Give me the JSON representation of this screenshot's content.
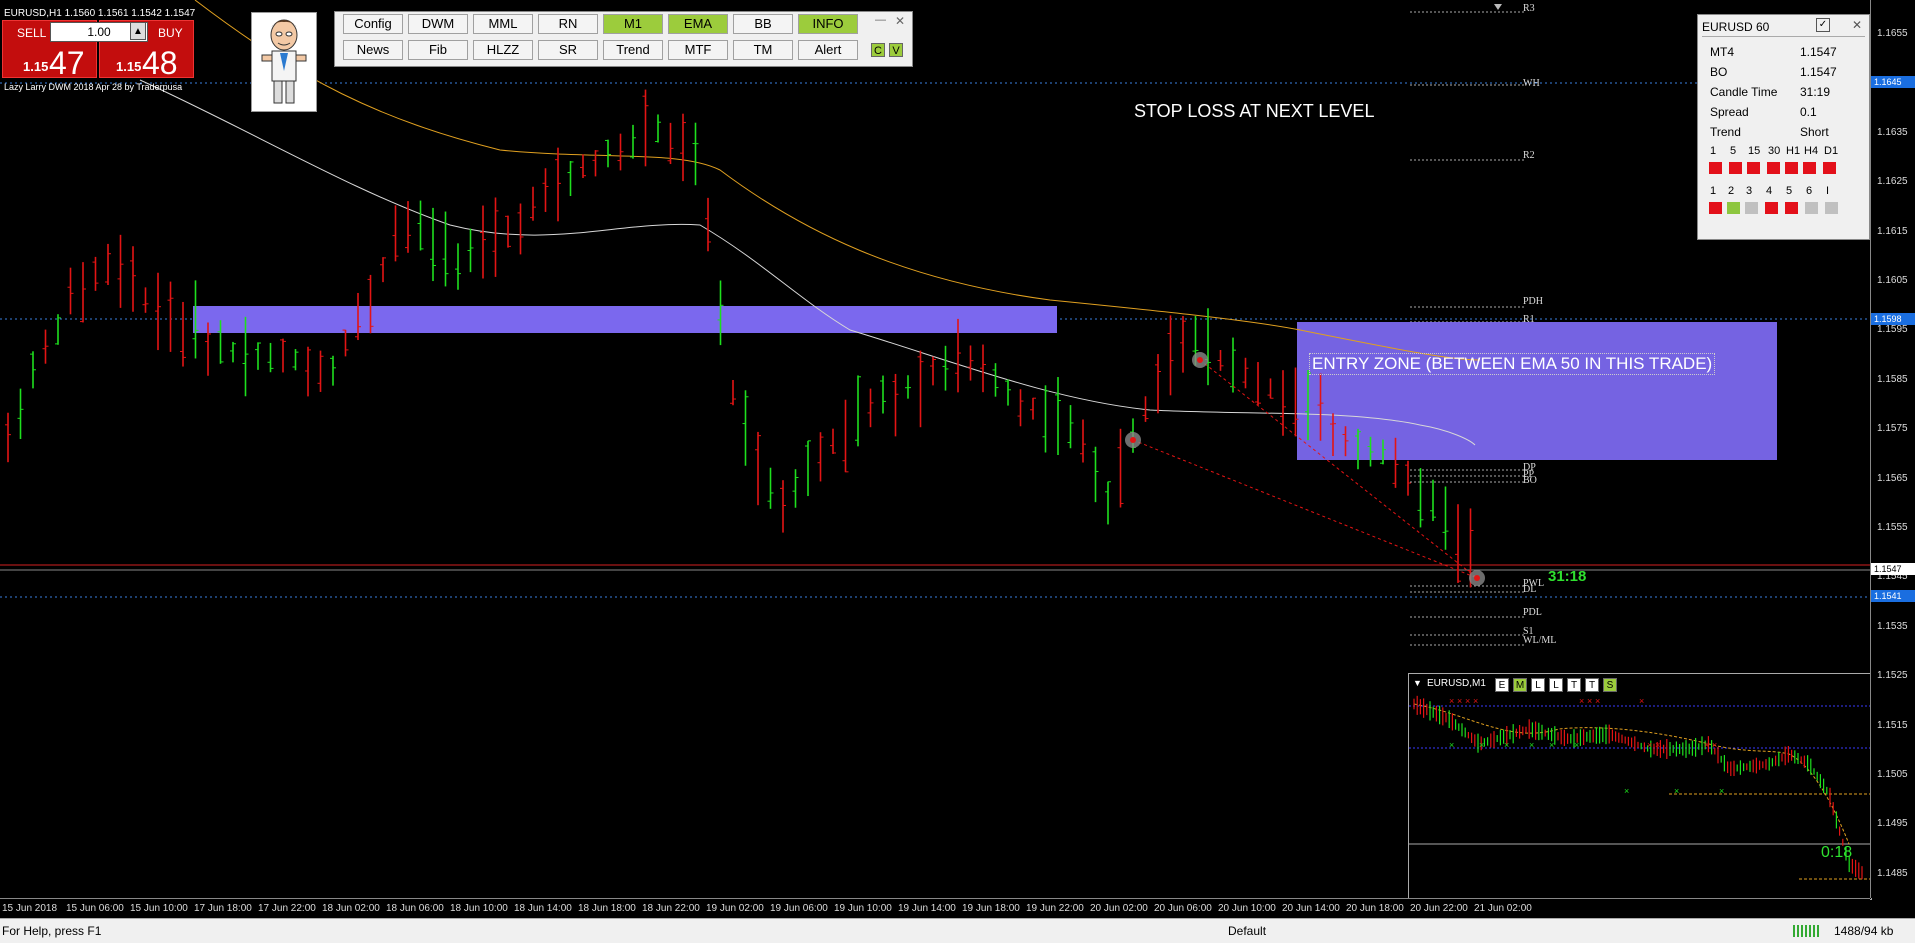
{
  "window": {
    "symbol_title": "EURUSD,H1  1.1560 1.1561 1.1542 1.1547",
    "author_label": "Lazy Larry DWM 2018 Apr 28 by Traderpusa"
  },
  "trade_panel": {
    "sell_label": "SELL",
    "buy_label": "BUY",
    "lot_value": "1.00",
    "spin_down": "▼",
    "spin_up": "▲",
    "sell_small": "1.15",
    "sell_big": "47",
    "buy_small": "1.15",
    "buy_big": "48"
  },
  "button_panel": {
    "row1": [
      "Config",
      "DWM",
      "MML",
      "RN",
      "M1",
      "EMA",
      "BB",
      "INFO"
    ],
    "row2": [
      "News",
      "Fib",
      "HLZZ",
      "SR",
      "Trend",
      "MTF",
      "TM",
      "Alert"
    ],
    "minimize": "—",
    "close": "✕",
    "c_label": "C",
    "v_label": "V"
  },
  "info_panel": {
    "title": "EURUSD  60",
    "close": "✕",
    "rows": [
      {
        "label": "MT4",
        "value": "1.1547"
      },
      {
        "label": "BO",
        "value": "1.1547"
      },
      {
        "label": "Candle Time",
        "value": "31:19"
      },
      {
        "label": "Spread",
        "value": "0.1"
      },
      {
        "label": "Trend",
        "value": "Short"
      }
    ],
    "timeframes": [
      "1",
      "5",
      "15",
      "30",
      "H1",
      "H4",
      "D1"
    ],
    "timeframe_colors": [
      "#e3101a",
      "#e3101a",
      "#e3101a",
      "#e3101a",
      "#e3101a",
      "#e3101a",
      "#e3101a"
    ],
    "signals": [
      "1",
      "2",
      "3",
      "4",
      "5",
      "6",
      "I"
    ],
    "signal_colors": [
      "#e3101a",
      "#8dc63f",
      "#c0c0c0",
      "#e3101a",
      "#e3101a",
      "#c0c0c0",
      "#c0c0c0"
    ]
  },
  "annotations": {
    "stop_loss": "STOP LOSS AT NEXT LEVEL",
    "entry_zone": "ENTRY ZONE (BETWEEN EMA 50 IN THIS TRADE)",
    "timer": "31:18"
  },
  "levels": {
    "r3": "R3",
    "wh": "WH",
    "r2": "R2",
    "pdh": "PDH",
    "r1": "R1",
    "dp": "DP",
    "pp": "PP",
    "bo": "BO",
    "pwl": "PWL",
    "dl": "DL",
    "pdl": "PDL",
    "s1": "S1",
    "wl_ml": "WL/ML"
  },
  "price_axis": [
    "1.1655",
    "1.1645",
    "1.1635",
    "1.1625",
    "1.1615",
    "1.1605",
    "1.1595",
    "1.1585",
    "1.1575",
    "1.1565",
    "1.1555",
    "1.1545",
    "1.1535",
    "1.1525",
    "1.1515",
    "1.1505",
    "1.1495",
    "1.1485"
  ],
  "price_tags": {
    "top_blue": "1.1645",
    "mid_blue": "1.1598",
    "current": "1.1547",
    "low_blue": "1.1541"
  },
  "time_axis": [
    "15 Jun 2018",
    "15 Jun 06:00",
    "15 Jun 10:00",
    "17 Jun 18:00",
    "17 Jun 22:00",
    "18 Jun 02:00",
    "18 Jun 06:00",
    "18 Jun 10:00",
    "18 Jun 14:00",
    "18 Jun 18:00",
    "18 Jun 22:00",
    "19 Jun 02:00",
    "19 Jun 06:00",
    "19 Jun 10:00",
    "19 Jun 14:00",
    "19 Jun 18:00",
    "19 Jun 22:00",
    "20 Jun 02:00",
    "20 Jun 06:00",
    "20 Jun 10:00",
    "20 Jun 14:00",
    "20 Jun 18:00",
    "20 Jun 22:00",
    "21 Jun 02:00"
  ],
  "mini_chart": {
    "title": "EURUSD,M1",
    "buttons": [
      "E",
      "M",
      "L",
      "L",
      "T",
      "T",
      "S"
    ],
    "timer": "0:18"
  },
  "status_bar": {
    "help": "For Help, press F1",
    "profile": "Default",
    "traffic": "1488/94 kb"
  }
}
